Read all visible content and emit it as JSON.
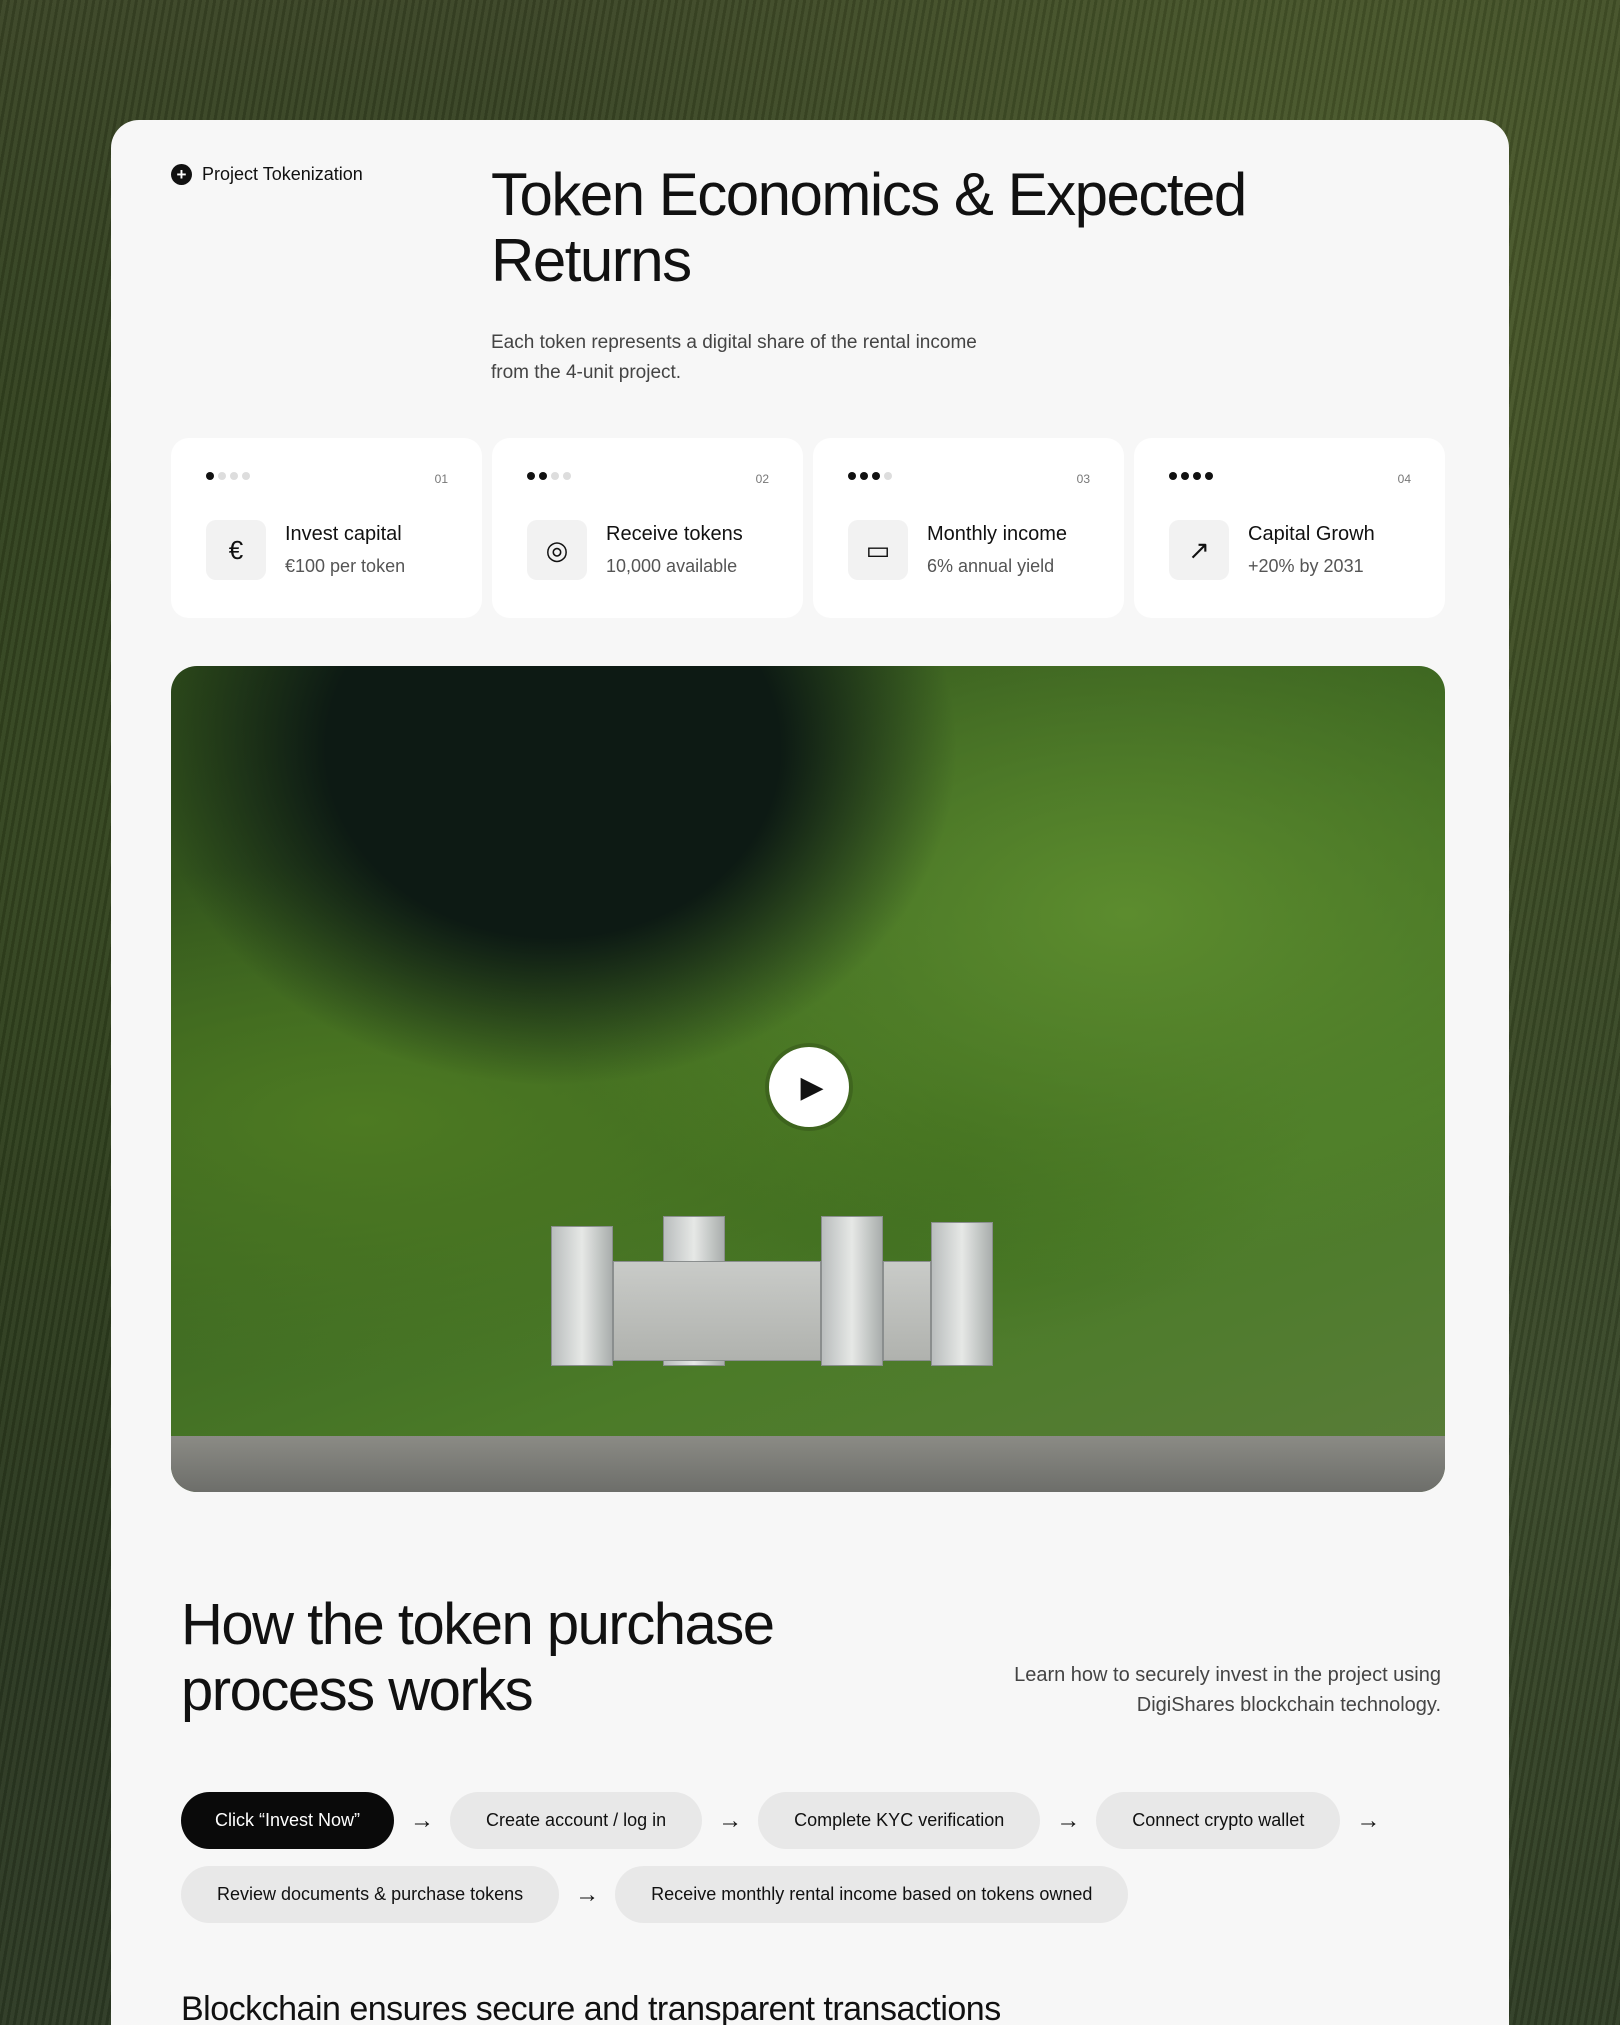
{
  "section_tag": "Project Tokenization",
  "title": "Token Economics & Expected Returns",
  "subtitle": "Each token represents a digital share of the rental income from the 4-unit project.",
  "features": [
    {
      "number": "01",
      "level": 1,
      "icon": "euro-icon",
      "glyph": "€",
      "title": "Invest capital",
      "subtitle": "€100 per token"
    },
    {
      "number": "02",
      "level": 2,
      "icon": "tokens-icon",
      "glyph": "◎",
      "title": "Receive tokens",
      "subtitle": "10,000 available"
    },
    {
      "number": "03",
      "level": 3,
      "icon": "wallet-icon",
      "glyph": "▭",
      "title": "Monthly income",
      "subtitle": "6% annual yield"
    },
    {
      "number": "04",
      "level": 4,
      "icon": "trend-up-icon",
      "glyph": "↗",
      "title": "Capital Growh",
      "subtitle": "+20% by 2031"
    }
  ],
  "video": {
    "play_icon": "play-icon",
    "play_glyph": "▶"
  },
  "process": {
    "title": "How the token purchase process works",
    "description": "Learn how to securely invest in the project using DigiShares blockchain technology.",
    "arrow_glyph": "→",
    "row1": [
      "Click “Invest Now”",
      "Create account / log in",
      "Complete KYC verification",
      "Connect crypto wallet"
    ],
    "row2": [
      "Review documents & purchase tokens",
      "Receive monthly rental income based on tokens owned"
    ]
  },
  "next_heading": "Blockchain ensures secure and transparent transactions"
}
